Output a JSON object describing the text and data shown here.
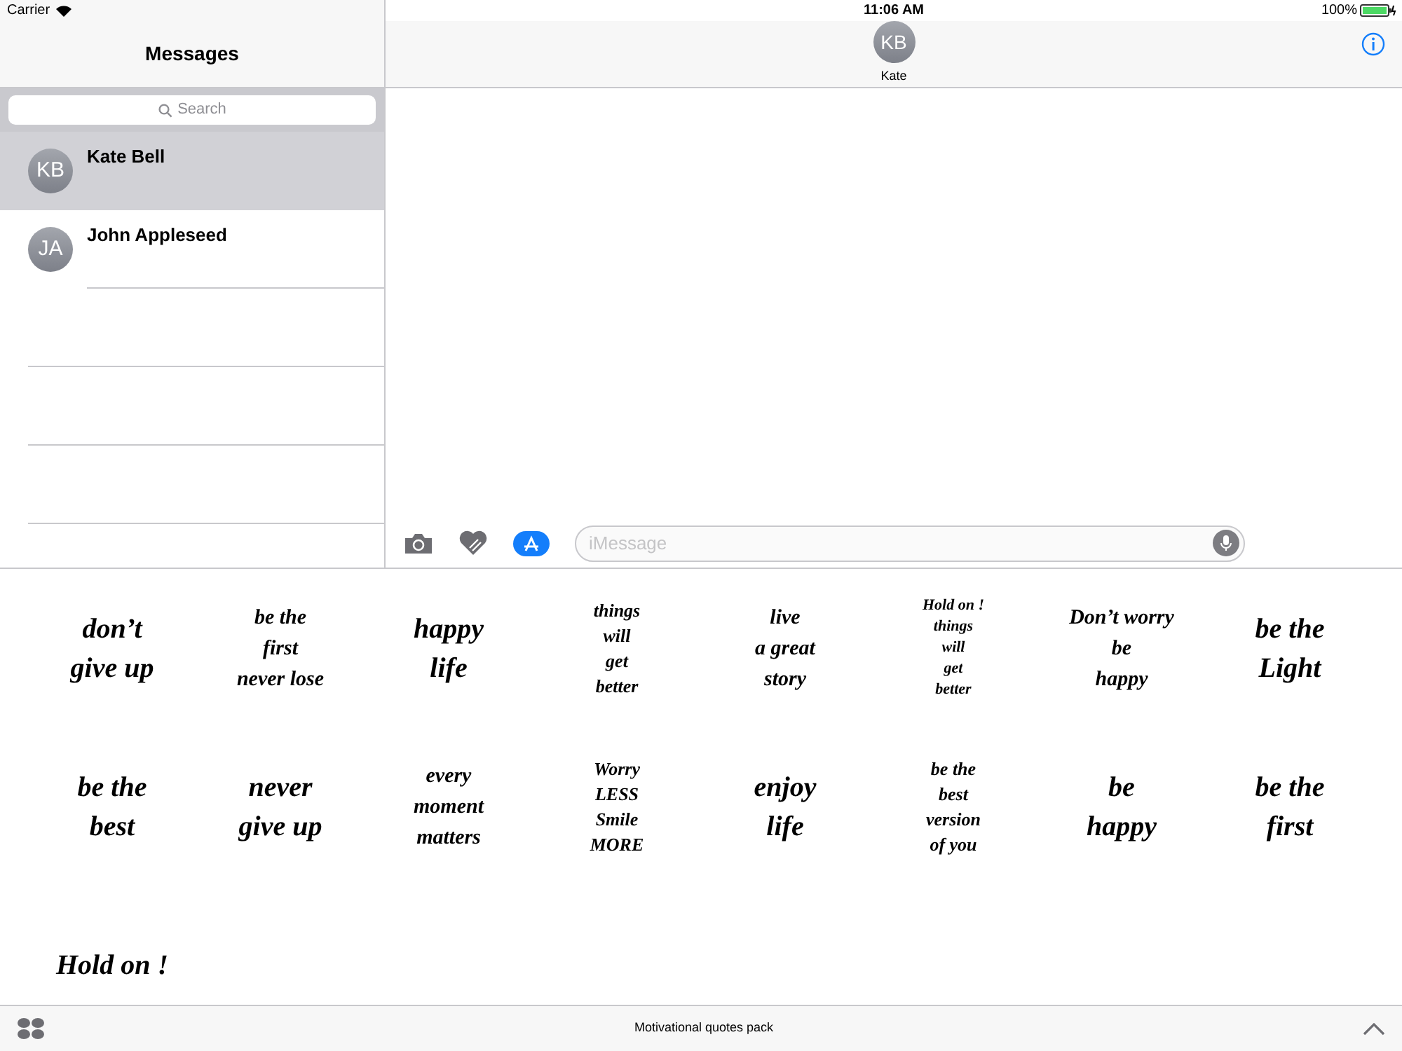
{
  "status_bar": {
    "carrier": "Carrier",
    "time": "11:06 AM",
    "battery": "100%"
  },
  "sidebar": {
    "title": "Messages",
    "search": {
      "placeholder": "Search"
    },
    "conversations": [
      {
        "initials": "KB",
        "name": "Kate Bell",
        "selected": true
      },
      {
        "initials": "JA",
        "name": "John Appleseed",
        "selected": false
      }
    ]
  },
  "chat": {
    "contact": {
      "initials": "KB",
      "name": "Kate"
    },
    "composer": {
      "placeholder": "iMessage"
    }
  },
  "stickers": [
    {
      "lines": [
        "don’t",
        "give up"
      ]
    },
    {
      "lines": [
        "be the",
        "first",
        "never lose"
      ]
    },
    {
      "lines": [
        "happy",
        "life"
      ]
    },
    {
      "lines": [
        "things",
        "will",
        "get",
        "better"
      ]
    },
    {
      "lines": [
        "live",
        "a great",
        "story"
      ]
    },
    {
      "lines": [
        "Hold on !",
        "things",
        "will",
        "get",
        "better"
      ]
    },
    {
      "lines": [
        "Don’t worry",
        "be",
        "happy"
      ]
    },
    {
      "lines": [
        "be the",
        "Light"
      ]
    },
    {
      "lines": [
        "be the",
        "best"
      ]
    },
    {
      "lines": [
        "never",
        "give up"
      ]
    },
    {
      "lines": [
        "every",
        "moment",
        "matters"
      ]
    },
    {
      "lines": [
        "Worry",
        "LESS",
        "Smile",
        "MORE"
      ]
    },
    {
      "lines": [
        "enjoy",
        "life"
      ]
    },
    {
      "lines": [
        "be the",
        "best",
        "version",
        "of you"
      ]
    },
    {
      "lines": [
        "be",
        "happy"
      ]
    },
    {
      "lines": [
        "be the",
        "first"
      ]
    },
    {
      "lines": [
        "Hold on !"
      ]
    }
  ],
  "app_bar": {
    "title": "Motivational quotes pack"
  }
}
